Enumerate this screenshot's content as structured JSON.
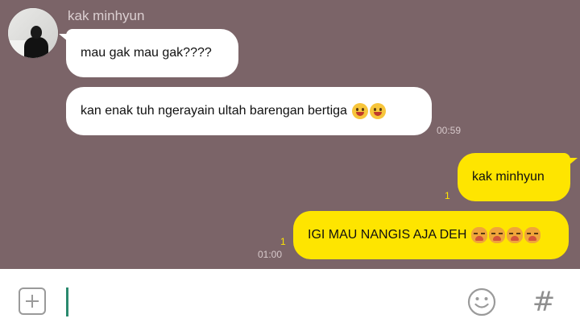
{
  "chat": {
    "sender_name": "kak minhyun",
    "messages": [
      {
        "direction": "in",
        "text": "mau gak mau gak????",
        "emojis": []
      },
      {
        "direction": "in",
        "text": "kan enak tuh ngerayain ultah barengan bertiga",
        "emojis": [
          "grinning-face",
          "grinning-face"
        ],
        "time": "00:59"
      },
      {
        "direction": "out",
        "text": "kak minhyun",
        "unread": "1"
      },
      {
        "direction": "out",
        "text": "IGI MAU NANGIS AJA DEH",
        "emojis": [
          "crying-face",
          "crying-face",
          "crying-face",
          "crying-face"
        ],
        "unread": "1",
        "time": "01:00"
      }
    ]
  },
  "input": {
    "value": "",
    "icons": [
      "plus-icon",
      "emoji-icon",
      "hash-icon"
    ],
    "hash_glyph": "#"
  },
  "colors": {
    "chat_background": "#7b6468",
    "incoming_bubble": "#ffffff",
    "outgoing_bubble": "#fee500",
    "unread_count": "#fee500",
    "caret": "#2a8a6e"
  }
}
